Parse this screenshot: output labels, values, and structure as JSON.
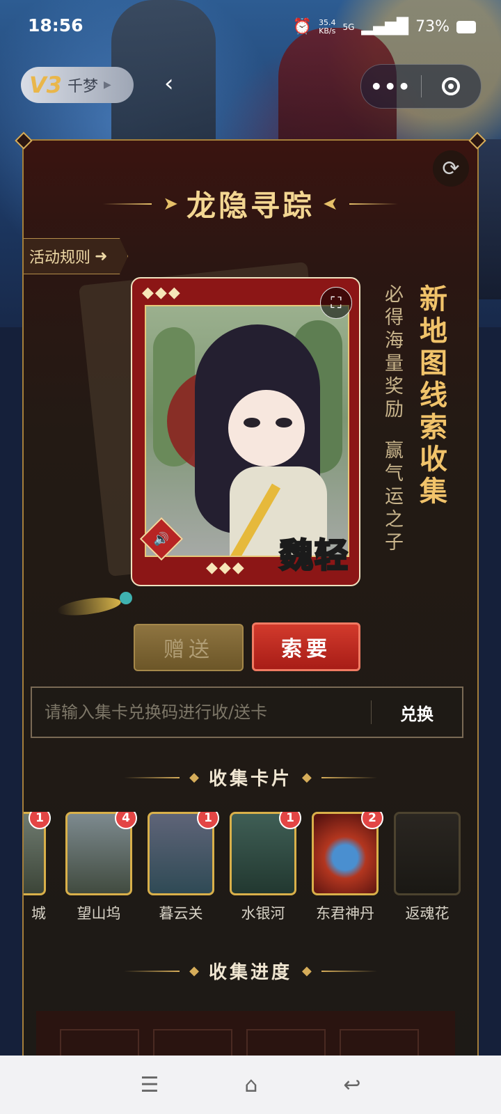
{
  "status_bar": {
    "time": "18:56",
    "net_speed_value": "35.4",
    "net_speed_unit": "KB/s",
    "signal": "5G",
    "battery": "73%"
  },
  "top_bar": {
    "vip_level": "V3",
    "user_name": "千梦",
    "back_icon": "chevron-left-icon",
    "more_icon": "more-dots-icon",
    "close_icon": "target-icon"
  },
  "panel": {
    "title": "龙隐寻踪",
    "rules_label": "活动规则",
    "refresh_icon": "refresh-icon"
  },
  "main_card": {
    "name": "魏轻",
    "diamonds": "◆◆◆"
  },
  "slogans": {
    "big": "新地图线索收集",
    "small_1": "必得海量奖励",
    "small_2": "赢气运之子"
  },
  "actions": {
    "gift_label": "赠送",
    "request_label": "索要"
  },
  "redeem": {
    "placeholder": "请输入集卡兑换码进行收/送卡",
    "button_label": "兑换"
  },
  "collect_section": {
    "title": "收集卡片",
    "cards": [
      {
        "label": "城",
        "count": "1"
      },
      {
        "label": "望山坞",
        "count": "4"
      },
      {
        "label": "暮云关",
        "count": "1"
      },
      {
        "label": "水银河",
        "count": "1"
      },
      {
        "label": "东君神丹",
        "count": "2"
      },
      {
        "label": "返魂花",
        "count": ""
      }
    ]
  },
  "progress_section": {
    "title": "收集进度"
  },
  "colors": {
    "accent_gold": "#d6ad5a",
    "request_red": "#c22d24",
    "badge_red": "#e34545"
  }
}
